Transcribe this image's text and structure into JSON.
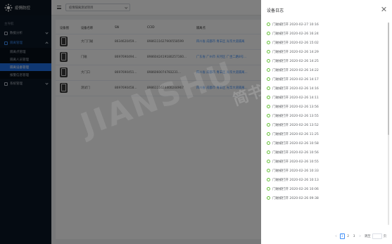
{
  "app": {
    "title": "疫情防控"
  },
  "sidebar": {
    "heading": "主导航",
    "items": [
      {
        "label": "数据分析"
      },
      {
        "label": "隔离管理"
      },
      {
        "label": "系统管理"
      }
    ],
    "sub_items": [
      {
        "label": "隔离点管理"
      },
      {
        "label": "隔离人员管理"
      },
      {
        "label": "隔离设备管理"
      },
      {
        "label": "报警信息管理"
      }
    ]
  },
  "topbar": {
    "project_select": "疫情隔离测试项目"
  },
  "table": {
    "headers": [
      "设备图",
      "设备名称",
      "SN",
      "CCID",
      "隔离点"
    ],
    "rows": [
      {
        "name": "大门门磁",
        "sn": "8634620459...",
        "ccid": "8986111627900558599",
        "addr": "四川省 成都市 青羊区 光华大道隔离"
      },
      {
        "name": "门磁",
        "sn": "8697690494...",
        "ccid": "8986042419180257160...",
        "addr": "广东省 广州市 天河区 广坐二路8号..."
      },
      {
        "name": "大门口",
        "sn": "8697690451...",
        "ccid": "8986060074783231...",
        "addr": "四川省 成都市 青羊区 光华大道隔离..."
      },
      {
        "name": "测试门",
        "sn": "8697690458...",
        "ccid": "8986111624400244967",
        "addr": "四川省 成都市 青羊区 光华大道隔离..."
      }
    ]
  },
  "watermark": {
    "text": "JIANSHU",
    "cn": "简书"
  },
  "drawer": {
    "title": "设备日志",
    "logs": [
      "门磁被打开 2020-02-27 10:16",
      "门磁被打开 2020-02-26 16:24",
      "门磁被打开 2020-02-26 15:02",
      "门磁被打开 2020-02-26 14:29",
      "门磁被打开 2020-02-26 14:25",
      "门磁被打开 2020-02-26 14:22",
      "门磁被打开 2020-02-26 14:17",
      "门磁被打开 2020-02-26 14:16",
      "门磁被打开 2020-02-26 14:11",
      "门磁被打开 2020-02-26 13:56",
      "门磁被打开 2020-02-26 13:55",
      "门磁被打开 2020-02-26 13:52",
      "门磁被打开 2020-02-26 11:25",
      "门磁被打开 2020-02-26 10:58",
      "门磁被打开 2020-02-26 10:56",
      "门磁被打开 2020-02-26 10:55",
      "门磁被打开 2020-02-26 10:33",
      "门磁被打开 2020-02-26 10:13",
      "门磁被打开 2020-02-26 10:06",
      "门磁被打开 2020-02-26 09:38"
    ],
    "pager": {
      "pages": [
        "1",
        "2",
        "3"
      ],
      "active": "1",
      "prev": "<",
      "next": ">",
      "goto_label": "跳至",
      "page_suffix": "页"
    }
  }
}
